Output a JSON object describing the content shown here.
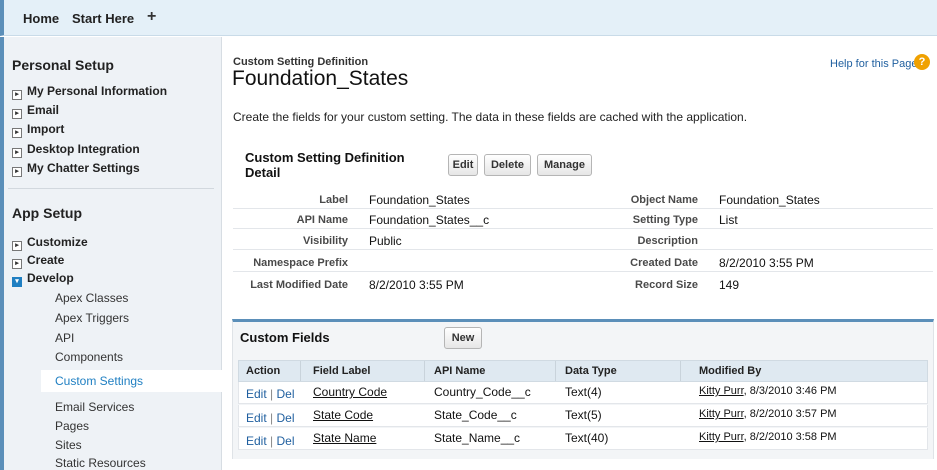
{
  "topbar": {
    "home": "Home",
    "start_here": "Start Here",
    "add": "+"
  },
  "sidebar": {
    "personal_setup": "Personal Setup",
    "personal_items": [
      "My Personal Information",
      "Email",
      "Import",
      "Desktop Integration",
      "My Chatter Settings"
    ],
    "app_setup": "App Setup",
    "app_items": [
      "Customize",
      "Create",
      "Develop"
    ],
    "develop_items": [
      "Apex Classes",
      "Apex Triggers",
      "API",
      "Components",
      "Custom Settings",
      "Email Services",
      "Pages",
      "Sites",
      "Static Resources"
    ],
    "collapsed_glyph": "▸",
    "expanded_glyph": "▾"
  },
  "page": {
    "breadcrumb": "Custom Setting Definition",
    "title": "Foundation_States",
    "help_link": "Help for this Page",
    "help_glyph": "?",
    "description": "Create the fields for your custom setting. The data in these fields are cached with the application."
  },
  "detail": {
    "heading": "Custom Setting Definition Detail",
    "buttons": {
      "edit": "Edit",
      "delete": "Delete",
      "manage": "Manage"
    },
    "fields": {
      "label_label": "Label",
      "label_value": "Foundation_States",
      "api_label": "API Name",
      "api_value": "Foundation_States__c",
      "visibility_label": "Visibility",
      "visibility_value": "Public",
      "namespace_label": "Namespace Prefix",
      "namespace_value": "",
      "modified_label": "Last Modified Date",
      "modified_value": "8/2/2010 3:55 PM",
      "object_label": "Object Name",
      "object_value": "Foundation_States",
      "type_label": "Setting Type",
      "type_value": "List",
      "description_label": "Description",
      "description_value": "",
      "created_label": "Created Date",
      "created_value": "8/2/2010 3:55 PM",
      "size_label": "Record Size",
      "size_value": "149"
    }
  },
  "custom_fields": {
    "heading": "Custom Fields",
    "new_button": "New",
    "columns": [
      "Action",
      "Field Label",
      "API Name",
      "Data Type",
      "Modified By"
    ],
    "rows": [
      {
        "edit": "Edit",
        "sep": "|",
        "del": "Del",
        "label": "Country Code",
        "api": "Country_Code__c",
        "type": "Text(4)",
        "user": "Kitty Purr",
        "date": ", 8/3/2010 3:46 PM"
      },
      {
        "edit": "Edit",
        "sep": "|",
        "del": "Del",
        "label": "State Code",
        "api": "State_Code__c",
        "type": "Text(5)",
        "user": "Kitty Purr",
        "date": ", 8/2/2010 3:57 PM"
      },
      {
        "edit": "Edit",
        "sep": "|",
        "del": "Del",
        "label": "State Name",
        "api": "State_Name__c",
        "type": "Text(40)",
        "user": "Kitty Purr",
        "date": ", 8/2/2010 3:58 PM"
      }
    ]
  },
  "colors": {
    "accent": "#5b8fb9",
    "link": "#1f5f9f",
    "selected_text": "#1f7fc2",
    "help_icon": "#f0a100"
  }
}
